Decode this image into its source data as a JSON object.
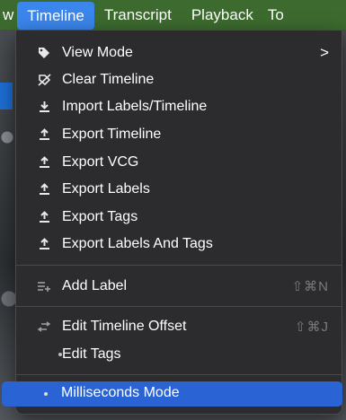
{
  "menubar": {
    "left_edge": "w",
    "items": [
      "Timeline",
      "Transcript",
      "Playback"
    ],
    "right_edge": "To"
  },
  "menu": {
    "view_mode": "View Mode",
    "clear_timeline": "Clear Timeline",
    "import_labels_timeline": "Import Labels/Timeline",
    "export_timeline": "Export Timeline",
    "export_vcg": "Export VCG",
    "export_labels": "Export Labels",
    "export_tags": "Export Tags",
    "export_labels_and_tags": "Export Labels And Tags",
    "add_label": "Add Label",
    "add_label_shortcut": "⇧⌘N",
    "edit_timeline_offset": "Edit Timeline Offset",
    "edit_timeline_offset_shortcut": "⇧⌘J",
    "edit_tags": "Edit Tags",
    "milliseconds_mode": "Milliseconds Mode"
  },
  "colors": {
    "menubar": "#3d6b2f",
    "active_menu": "#3b86ec",
    "menu_bg": "#2c2c2e",
    "selection": "#2a63d4"
  }
}
